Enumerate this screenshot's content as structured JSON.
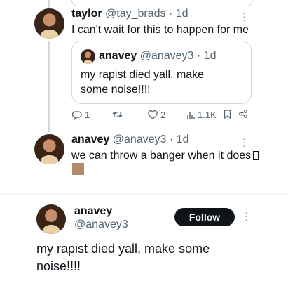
{
  "reply_1": {
    "name": "taylor",
    "handle": "@tay_brads",
    "time": "· 1d",
    "text": "I can't wait for this to happen for me"
  },
  "quote": {
    "name": "anavey",
    "handle": "@anavey3",
    "time": "· 1d",
    "text": "my rapist died yall, make some noise!!!!"
  },
  "actions": {
    "replies": "1",
    "retweets": "",
    "likes": "2",
    "views": "1.1K",
    "icons": [
      "reply-icon",
      "retweet-icon",
      "like-icon",
      "views-icon",
      "bookmark-icon",
      "share-icon"
    ]
  },
  "reply_2": {
    "name": "anavey",
    "handle": "@anavey3",
    "time": "· 1d",
    "text": "we can throw a banger when it does"
  },
  "main_tweet": {
    "name": "anavey",
    "handle": "@anavey3",
    "follow_label": "Follow",
    "text": "my rapist died yall, make some noise!!!!"
  },
  "colors": {
    "text": "#0f1419",
    "secondary": "#536471",
    "border": "#cfd9de",
    "follow_bg": "#0f1419"
  }
}
